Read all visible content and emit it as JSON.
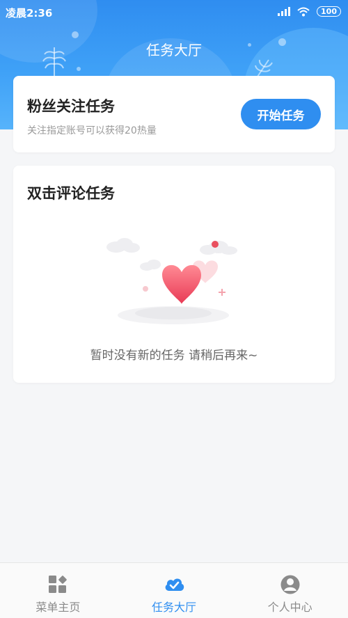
{
  "status_bar": {
    "time": "凌晨2:36",
    "battery": "100"
  },
  "header": {
    "title": "任务大厅"
  },
  "follow_task": {
    "title": "粉丝关注任务",
    "description": "关注指定账号可以获得20热量",
    "button_label": "开始任务"
  },
  "comment_task": {
    "title": "双击评论任务",
    "empty_text": "暂时没有新的任务 请稍后再来~"
  },
  "tabbar": {
    "items": [
      {
        "label": "菜单主页",
        "icon": "grid-icon"
      },
      {
        "label": "任务大厅",
        "icon": "cloud-check-icon"
      },
      {
        "label": "个人中心",
        "icon": "person-icon"
      }
    ],
    "active_index": 1
  },
  "colors": {
    "accent": "#2f8ef0",
    "heart": "#ef4d63",
    "inactive": "#8a8a8a"
  }
}
